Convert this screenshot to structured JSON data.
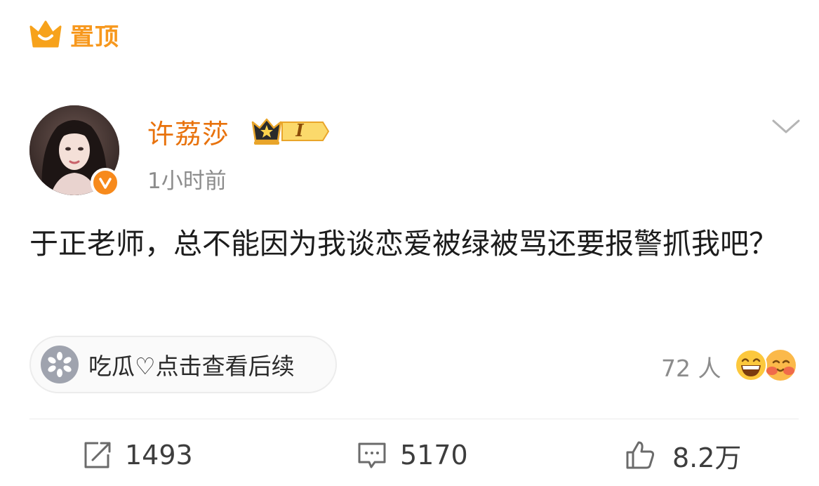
{
  "pin": {
    "label": "置顶",
    "icon": "crown-icon",
    "color": "#f7981d"
  },
  "user": {
    "name": "许荔莎",
    "name_color": "#e8720c",
    "member_badge": {
      "icon": "crown-member-badge",
      "level": "I"
    },
    "verified_icon": "verified-v-badge",
    "avatar": "user-avatar-photo"
  },
  "post": {
    "timestamp": "1小时前",
    "text": "于正老师，总不能因为我谈恋爱被绿被骂还要报警抓我吧？"
  },
  "topic": {
    "icon": "melon-seed-icon",
    "label": "吃瓜♡点击查看后续"
  },
  "reactions": {
    "count_label": "72 人",
    "emojis": [
      "laughing-emoji",
      "hug-emoji"
    ]
  },
  "actions": {
    "repost_count": "1493",
    "comment_count": "5170",
    "like_count": "8.2万"
  },
  "menu": {
    "icon": "chevron-down-icon"
  }
}
